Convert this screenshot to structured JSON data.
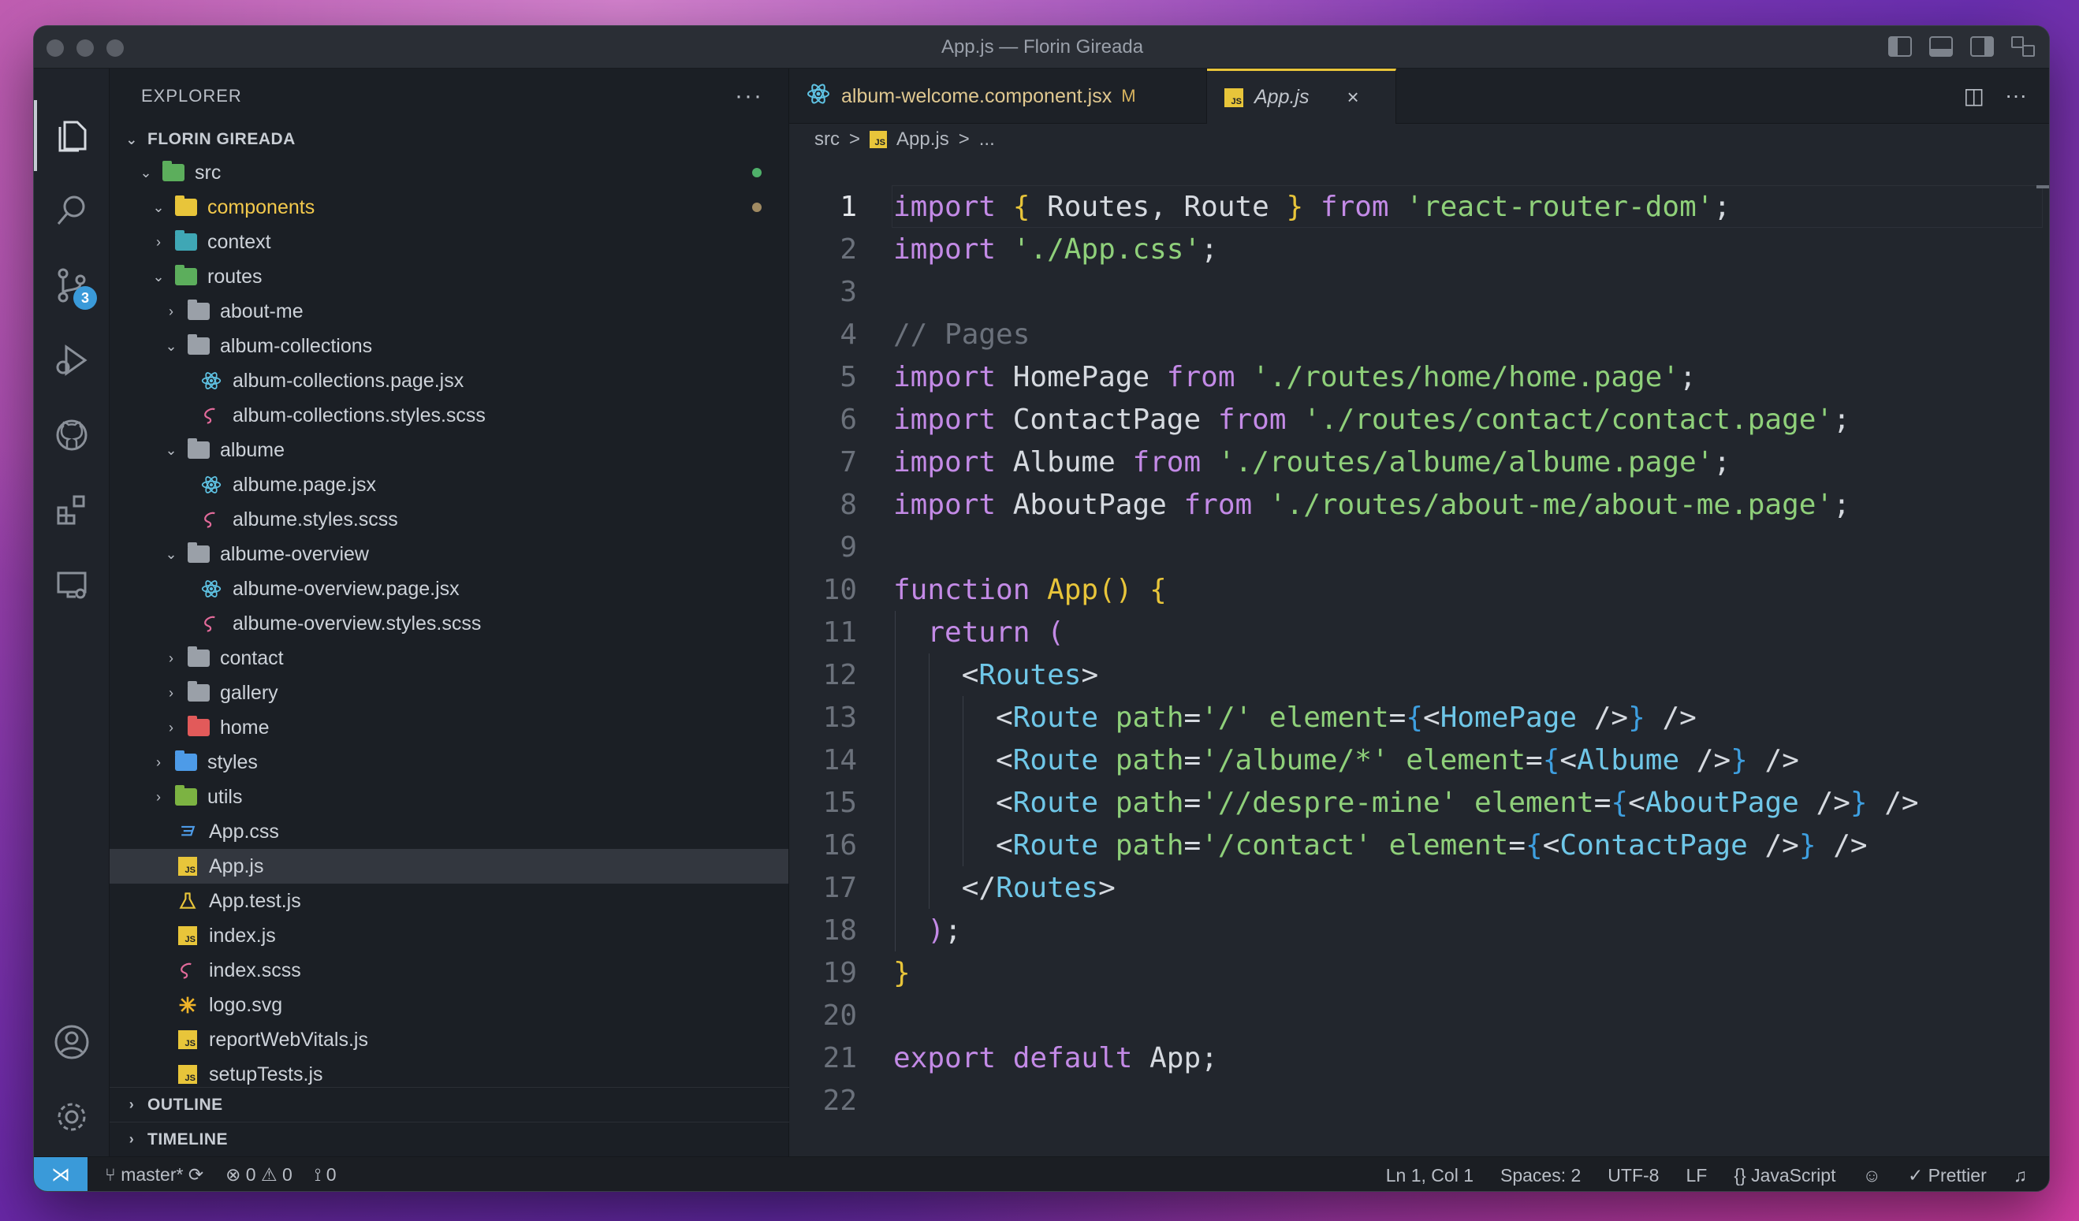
{
  "window": {
    "title": "App.js — Florin Gireada"
  },
  "activity_bar": {
    "items": [
      "files-icon",
      "search-icon",
      "source-control-icon",
      "run-debug-icon",
      "github-icon",
      "extensions-icon",
      "remote-explorer-icon"
    ],
    "source_control_badge": "3",
    "bottom": [
      "account-icon",
      "settings-icon"
    ]
  },
  "sidebar": {
    "header": "EXPLORER",
    "more": "···",
    "workspace": "FLORIN GIREADA",
    "tree": [
      {
        "label": "src",
        "depth": 0,
        "kind": "folder-open",
        "icon": "src-folder-icon",
        "dot": "#4fb06a"
      },
      {
        "label": "components",
        "depth": 1,
        "kind": "folder-open",
        "icon": "components-folder-icon",
        "dot": "#a08a62",
        "highlight": true
      },
      {
        "label": "context",
        "depth": 1,
        "kind": "folder-closed",
        "icon": "context-folder-icon"
      },
      {
        "label": "routes",
        "depth": 1,
        "kind": "folder-open",
        "icon": "routes-folder-icon"
      },
      {
        "label": "about-me",
        "depth": 2,
        "kind": "folder-closed",
        "icon": "folder-icon"
      },
      {
        "label": "album-collections",
        "depth": 2,
        "kind": "folder-open",
        "icon": "folder-icon"
      },
      {
        "label": "album-collections.page.jsx",
        "depth": 3,
        "kind": "file",
        "icon": "react-icon"
      },
      {
        "label": "album-collections.styles.scss",
        "depth": 3,
        "kind": "file",
        "icon": "sass-icon"
      },
      {
        "label": "albume",
        "depth": 2,
        "kind": "folder-open",
        "icon": "folder-icon"
      },
      {
        "label": "albume.page.jsx",
        "depth": 3,
        "kind": "file",
        "icon": "react-icon"
      },
      {
        "label": "albume.styles.scss",
        "depth": 3,
        "kind": "file",
        "icon": "sass-icon"
      },
      {
        "label": "albume-overview",
        "depth": 2,
        "kind": "folder-open",
        "icon": "folder-icon"
      },
      {
        "label": "albume-overview.page.jsx",
        "depth": 3,
        "kind": "file",
        "icon": "react-icon"
      },
      {
        "label": "albume-overview.styles.scss",
        "depth": 3,
        "kind": "file",
        "icon": "sass-icon"
      },
      {
        "label": "contact",
        "depth": 2,
        "kind": "folder-closed",
        "icon": "folder-icon"
      },
      {
        "label": "gallery",
        "depth": 2,
        "kind": "folder-closed",
        "icon": "folder-icon"
      },
      {
        "label": "home",
        "depth": 2,
        "kind": "folder-closed",
        "icon": "home-folder-icon"
      },
      {
        "label": "styles",
        "depth": 1,
        "kind": "folder-closed",
        "icon": "styles-folder-icon"
      },
      {
        "label": "utils",
        "depth": 1,
        "kind": "folder-closed",
        "icon": "utils-folder-icon"
      },
      {
        "label": "App.css",
        "depth": 1,
        "kind": "file",
        "icon": "css-icon"
      },
      {
        "label": "App.js",
        "depth": 1,
        "kind": "file",
        "icon": "js-icon",
        "selected": true
      },
      {
        "label": "App.test.js",
        "depth": 1,
        "kind": "file",
        "icon": "test-flask-icon"
      },
      {
        "label": "index.js",
        "depth": 1,
        "kind": "file",
        "icon": "js-icon"
      },
      {
        "label": "index.scss",
        "depth": 1,
        "kind": "file",
        "icon": "sass-icon"
      },
      {
        "label": "logo.svg",
        "depth": 1,
        "kind": "file",
        "icon": "svg-icon"
      },
      {
        "label": "reportWebVitals.js",
        "depth": 1,
        "kind": "file",
        "icon": "js-icon"
      },
      {
        "label": "setupTests.js",
        "depth": 1,
        "kind": "file",
        "icon": "js-icon"
      }
    ],
    "outline": "OUTLINE",
    "timeline": "TIMELINE"
  },
  "editor": {
    "tabs": [
      {
        "label": "album-welcome.component.jsx",
        "modified": "M",
        "icon": "react-icon"
      },
      {
        "label": "App.js",
        "close": "×",
        "icon": "js-icon",
        "active": true
      }
    ],
    "breadcrumb": {
      "root": "src",
      "sep": ">",
      "file": "App.js",
      "tail": "..."
    },
    "current_line": 1,
    "lines": [
      [
        [
          "k",
          "import"
        ],
        [
          "p",
          " "
        ],
        [
          "b1",
          "{"
        ],
        [
          "t",
          " Routes, Route "
        ],
        [
          "b1",
          "}"
        ],
        [
          "p",
          " "
        ],
        [
          "k",
          "from"
        ],
        [
          "p",
          " "
        ],
        [
          "s",
          "'react-router-dom'"
        ],
        [
          "p",
          ";"
        ]
      ],
      [
        [
          "k",
          "import"
        ],
        [
          "p",
          " "
        ],
        [
          "s",
          "'./App.css'"
        ],
        [
          "p",
          ";"
        ]
      ],
      [],
      [
        [
          "c",
          "// Pages"
        ]
      ],
      [
        [
          "k",
          "import"
        ],
        [
          "t",
          " HomePage "
        ],
        [
          "k",
          "from"
        ],
        [
          "p",
          " "
        ],
        [
          "s",
          "'./routes/home/home.page'"
        ],
        [
          "p",
          ";"
        ]
      ],
      [
        [
          "k",
          "import"
        ],
        [
          "t",
          " ContactPage "
        ],
        [
          "k",
          "from"
        ],
        [
          "p",
          " "
        ],
        [
          "s",
          "'./routes/contact/contact.page'"
        ],
        [
          "p",
          ";"
        ]
      ],
      [
        [
          "k",
          "import"
        ],
        [
          "t",
          " Albume "
        ],
        [
          "k",
          "from"
        ],
        [
          "p",
          " "
        ],
        [
          "s",
          "'./routes/albume/albume.page'"
        ],
        [
          "p",
          ";"
        ]
      ],
      [
        [
          "k",
          "import"
        ],
        [
          "t",
          " AboutPage "
        ],
        [
          "k",
          "from"
        ],
        [
          "p",
          " "
        ],
        [
          "s",
          "'./routes/about-me/about-me.page'"
        ],
        [
          "p",
          ";"
        ]
      ],
      [],
      [
        [
          "k",
          "function"
        ],
        [
          "p",
          " "
        ],
        [
          "f",
          "App"
        ],
        [
          "b1",
          "()"
        ],
        [
          "p",
          " "
        ],
        [
          "b1",
          "{"
        ]
      ],
      [
        [
          "p",
          "  "
        ],
        [
          "k",
          "return"
        ],
        [
          "p",
          " "
        ],
        [
          "b2",
          "("
        ]
      ],
      [
        [
          "p",
          "    "
        ],
        [
          "t",
          "<"
        ],
        [
          "a",
          "Routes"
        ],
        [
          "t",
          ">"
        ]
      ],
      [
        [
          "p",
          "      "
        ],
        [
          "t",
          "<"
        ],
        [
          "a",
          "Route"
        ],
        [
          "p",
          " "
        ],
        [
          "s",
          "path"
        ],
        [
          "t",
          "="
        ],
        [
          "s",
          "'/'"
        ],
        [
          "p",
          " "
        ],
        [
          "s",
          "element"
        ],
        [
          "t",
          "="
        ],
        [
          "b3",
          "{"
        ],
        [
          "t",
          "<"
        ],
        [
          "a",
          "HomePage"
        ],
        [
          "t",
          " />"
        ],
        [
          "b3",
          "}"
        ],
        [
          "t",
          " />"
        ]
      ],
      [
        [
          "p",
          "      "
        ],
        [
          "t",
          "<"
        ],
        [
          "a",
          "Route"
        ],
        [
          "p",
          " "
        ],
        [
          "s",
          "path"
        ],
        [
          "t",
          "="
        ],
        [
          "s",
          "'/albume/*'"
        ],
        [
          "p",
          " "
        ],
        [
          "s",
          "element"
        ],
        [
          "t",
          "="
        ],
        [
          "b3",
          "{"
        ],
        [
          "t",
          "<"
        ],
        [
          "a",
          "Albume"
        ],
        [
          "t",
          " />"
        ],
        [
          "b3",
          "}"
        ],
        [
          "t",
          " />"
        ]
      ],
      [
        [
          "p",
          "      "
        ],
        [
          "t",
          "<"
        ],
        [
          "a",
          "Route"
        ],
        [
          "p",
          " "
        ],
        [
          "s",
          "path"
        ],
        [
          "t",
          "="
        ],
        [
          "s",
          "'//despre-mine'"
        ],
        [
          "p",
          " "
        ],
        [
          "s",
          "element"
        ],
        [
          "t",
          "="
        ],
        [
          "b3",
          "{"
        ],
        [
          "t",
          "<"
        ],
        [
          "a",
          "AboutPage"
        ],
        [
          "t",
          " />"
        ],
        [
          "b3",
          "}"
        ],
        [
          "t",
          " />"
        ]
      ],
      [
        [
          "p",
          "      "
        ],
        [
          "t",
          "<"
        ],
        [
          "a",
          "Route"
        ],
        [
          "p",
          " "
        ],
        [
          "s",
          "path"
        ],
        [
          "t",
          "="
        ],
        [
          "s",
          "'/contact'"
        ],
        [
          "p",
          " "
        ],
        [
          "s",
          "element"
        ],
        [
          "t",
          "="
        ],
        [
          "b3",
          "{"
        ],
        [
          "t",
          "<"
        ],
        [
          "a",
          "ContactPage"
        ],
        [
          "t",
          " />"
        ],
        [
          "b3",
          "}"
        ],
        [
          "t",
          " />"
        ]
      ],
      [
        [
          "p",
          "    "
        ],
        [
          "t",
          "</"
        ],
        [
          "a",
          "Routes"
        ],
        [
          "t",
          ">"
        ]
      ],
      [
        [
          "p",
          "  "
        ],
        [
          "b2",
          ")"
        ],
        [
          "p",
          ";"
        ]
      ],
      [
        [
          "b1",
          "}"
        ]
      ],
      [],
      [
        [
          "k",
          "export"
        ],
        [
          "p",
          " "
        ],
        [
          "k",
          "default"
        ],
        [
          "t",
          " App;"
        ]
      ],
      []
    ]
  },
  "status_bar": {
    "remote_icon": "remote-icon",
    "branch": "master*",
    "errors": "0",
    "warnings": "0",
    "ports": "0",
    "position": "Ln 1, Col 1",
    "spaces": "Spaces: 2",
    "encoding": "UTF-8",
    "eol": "LF",
    "language": "JavaScript",
    "formatter": "Prettier"
  },
  "colors": {
    "accent": "#3a9ad9",
    "tab_active_border": "#e8c53a",
    "keyword": "#c38ae6",
    "string": "#8fd07a",
    "comment": "#6b717b"
  }
}
